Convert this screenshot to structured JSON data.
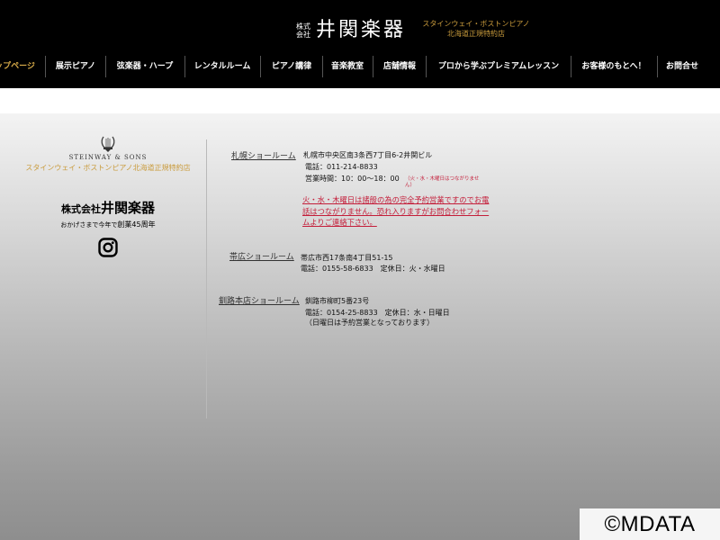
{
  "header": {
    "kabu_line1": "株式",
    "kabu_line2": "会社",
    "brand": "井関楽器",
    "tagline_line1": "スタインウェイ・ボストンピアノ",
    "tagline_line2": "北海道正規特約店"
  },
  "nav": {
    "items": [
      {
        "label": "トップページ"
      },
      {
        "label": "展示ピアノ"
      },
      {
        "label": "弦楽器・ハープ"
      },
      {
        "label": "レンタルルーム"
      },
      {
        "label": "ピアノ講律"
      },
      {
        "label": "音楽教室"
      },
      {
        "label": "店舗情報"
      },
      {
        "label": "プロから学ぶプレミアムレッスン"
      },
      {
        "label": "お客様のもとへ！"
      },
      {
        "label": "お問合せ"
      }
    ]
  },
  "sidebar": {
    "steinway": "STEINWAY & SONS",
    "dealer": "スタインウェイ・ボストンピアノ北海道正規特約店",
    "company_prefix": "株式会社",
    "company_name": "井関楽器",
    "anniv_a": "おかげさまで",
    "anniv_b": "今年で",
    "anniv_c": "創業45周年",
    "instagram_icon": "instagram-icon"
  },
  "showrooms": {
    "sapporo": {
      "name": "札幌ショールーム",
      "address": "札幌市中央区南3条西7丁目6-2井関ビル",
      "tel": "電話：011-214-8833",
      "hours": "営業時間：10：00〜18：00",
      "closed_line1": "（火・水・木曜日はつながりませ",
      "closed_line2": "ん）",
      "notice": "火・水・木曜日は諸般の為の完全予約営業ですのでお電話はつながりません。恐れ入りますがお問合わせフォームよりご連絡下さい。"
    },
    "obihiro": {
      "name": "帯広ショールーム",
      "address": "帯広市西17条南4丁目51-15",
      "tel": "電話：0155-58-6833　定休日：火・水曜日"
    },
    "kushiro": {
      "name": "釧路本店ショールーム",
      "address": "釧路市柳町5番23号",
      "tel": "電話：0154-25-8833　定休日：水・日曜日",
      "note": "（日曜日は予約営業となっております）"
    }
  },
  "watermark": "©MDATA",
  "colors": {
    "header_bg": "#000000",
    "accent_gold": "#c99b3c",
    "notice_red": "#c41e3a"
  }
}
